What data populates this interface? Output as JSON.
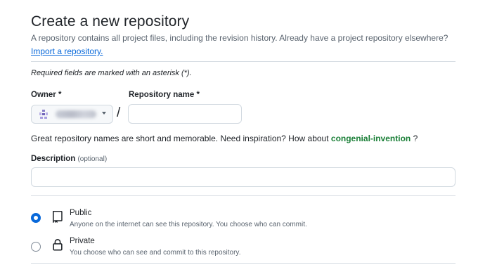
{
  "header": {
    "title": "Create a new repository",
    "subtitle": "A repository contains all project files, including the revision history. Already have a project repository elsewhere?",
    "import_link": "Import a repository."
  },
  "form": {
    "required_note": "Required fields are marked with an asterisk (*).",
    "owner_label": "Owner *",
    "owner_value": "aaktrar90",
    "separator": "/",
    "repo_name_label": "Repository name *",
    "repo_name_value": "",
    "hint_prefix": "Great repository names are short and memorable. Need inspiration? How about ",
    "hint_suggestion": "congenial-invention",
    "hint_suffix": " ?",
    "description_label": "Description",
    "description_optional": "(optional)",
    "description_value": ""
  },
  "visibility": {
    "options": [
      {
        "title": "Public",
        "description": "Anyone on the internet can see this repository. You choose who can commit.",
        "icon": "repo-icon",
        "selected": true
      },
      {
        "title": "Private",
        "description": "You choose who can see and commit to this repository.",
        "icon": "lock-icon",
        "selected": false
      }
    ]
  },
  "colors": {
    "accent": "#0969da",
    "suggestion": "#1a7f37",
    "muted_text": "#59636e",
    "border": "#d1d9e0"
  }
}
